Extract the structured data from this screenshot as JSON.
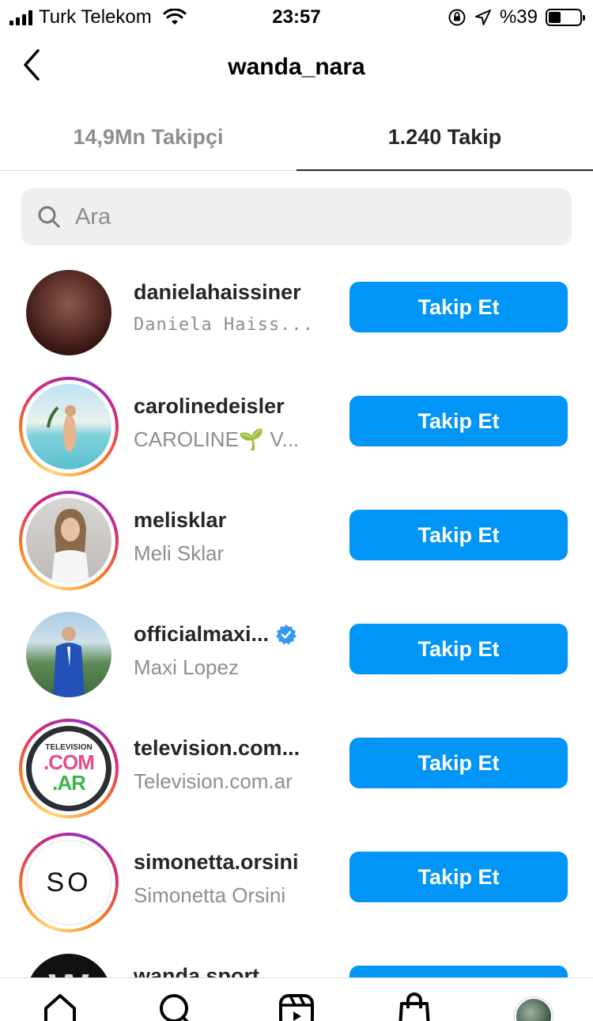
{
  "status_bar": {
    "carrier": "Turk Telekom",
    "time": "23:57",
    "battery": "%39",
    "battery_level": 0.39
  },
  "header": {
    "title": "wanda_nara"
  },
  "tabs": [
    {
      "label": "14,9Mn Takipçi",
      "active": false
    },
    {
      "label": "1.240 Takip",
      "active": true
    }
  ],
  "search": {
    "placeholder": "Ara",
    "value": ""
  },
  "users": [
    {
      "username": "danielahaissiner",
      "full_name": "Daniela Haiss...",
      "button": "Takip Et",
      "story": false,
      "verified": false
    },
    {
      "username": "carolinedeisler",
      "full_name": "CAROLINE🌱 V...",
      "button": "Takip Et",
      "story": true,
      "verified": false
    },
    {
      "username": "melisklar",
      "full_name": "Meli Sklar",
      "button": "Takip Et",
      "story": true,
      "verified": false
    },
    {
      "username": "officialmaxi...",
      "full_name": "Maxi Lopez",
      "button": "Takip Et",
      "story": false,
      "verified": true
    },
    {
      "username": "television.com...",
      "full_name": "Television.com.ar",
      "button": "Takip Et",
      "story": true,
      "verified": false,
      "logo_text": [
        "TELEVISION",
        ".COM",
        ".AR"
      ]
    },
    {
      "username": "simonetta.orsini",
      "full_name": "Simonetta Orsini",
      "button": "Takip Et",
      "story": true,
      "verified": false,
      "logo_text": [
        "SO"
      ]
    },
    {
      "username": "wanda.sport",
      "full_name": "",
      "button": "Takip Et",
      "story": false,
      "verified": false,
      "logo_text": [
        "W"
      ]
    }
  ],
  "colors": {
    "accent": "#0095f6",
    "secondary_text": "#8e8e8e",
    "search_bg": "#efefef"
  },
  "bottom_nav": [
    "home-icon",
    "search-icon",
    "reels-icon",
    "shop-icon",
    "profile-avatar"
  ]
}
